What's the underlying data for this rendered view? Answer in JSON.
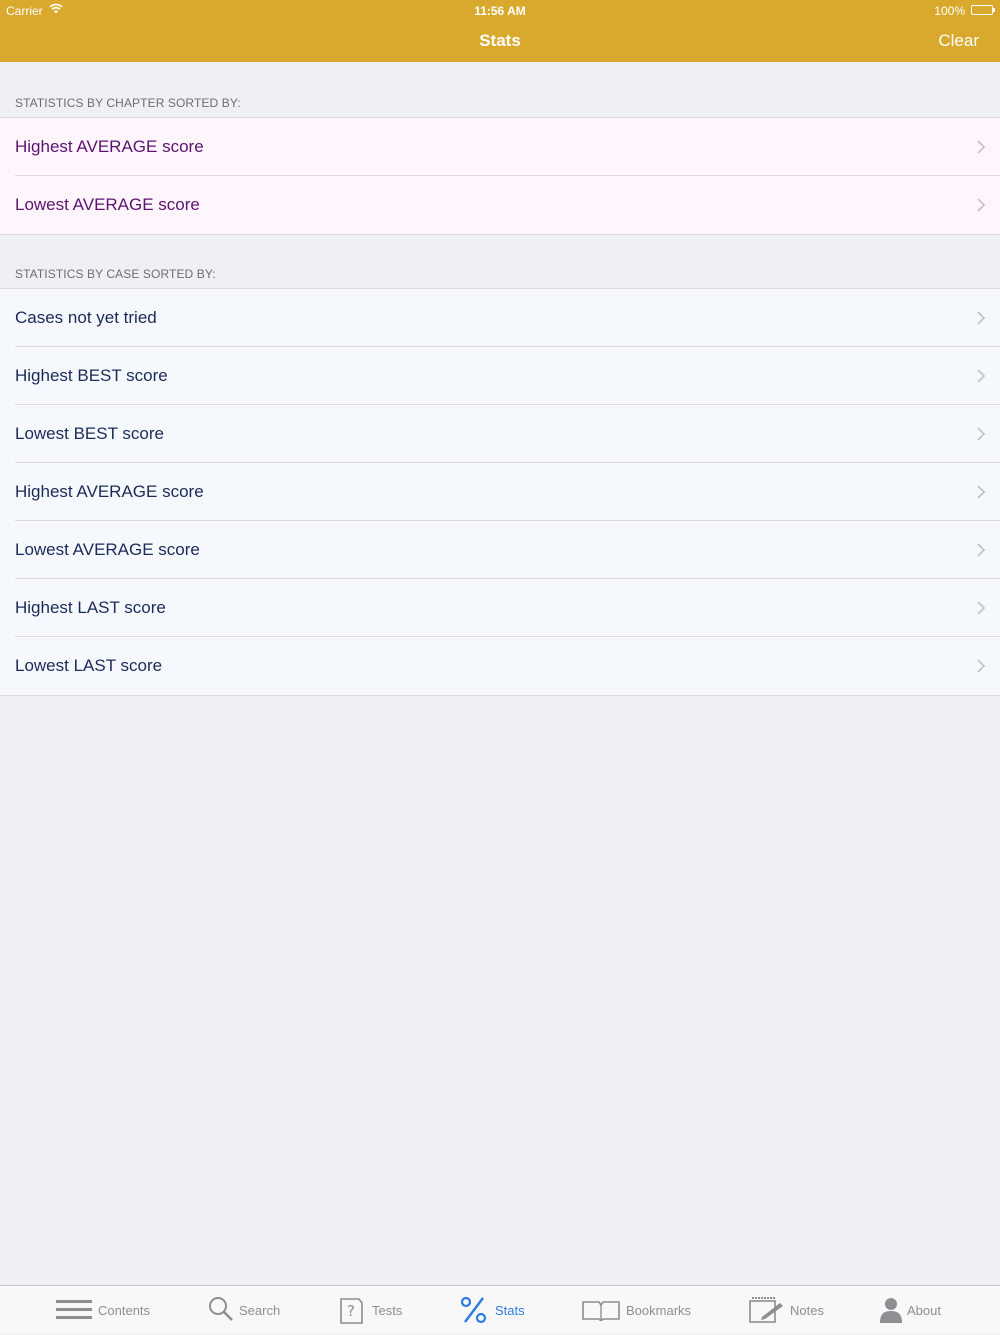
{
  "status_bar": {
    "carrier": "Carrier",
    "time": "11:56 AM",
    "battery": "100%"
  },
  "nav": {
    "title": "Stats",
    "right_button": "Clear"
  },
  "sections": [
    {
      "header": "STATISTICS BY CHAPTER SORTED BY:",
      "items": [
        "Highest AVERAGE score",
        "Lowest AVERAGE score"
      ]
    },
    {
      "header": "STATISTICS BY CASE SORTED BY:",
      "items": [
        "Cases not yet tried",
        "Highest BEST score",
        "Lowest BEST score",
        "Highest AVERAGE score",
        "Lowest AVERAGE score",
        "Highest LAST score",
        "Lowest LAST score"
      ]
    }
  ],
  "tabbar": {
    "tabs": [
      {
        "label": "Contents",
        "icon": "list-icon"
      },
      {
        "label": "Search",
        "icon": "search-icon"
      },
      {
        "label": "Tests",
        "icon": "question-icon"
      },
      {
        "label": "Stats",
        "icon": "percent-icon",
        "active": true
      },
      {
        "label": "Bookmarks",
        "icon": "book-icon"
      },
      {
        "label": "Notes",
        "icon": "notepad-icon"
      },
      {
        "label": "About",
        "icon": "person-icon"
      }
    ]
  },
  "colors": {
    "nav_bar": "#d8a92d",
    "active_tab": "#2f7be0",
    "chapter_text": "#5a1470",
    "case_text": "#1c2a57"
  }
}
